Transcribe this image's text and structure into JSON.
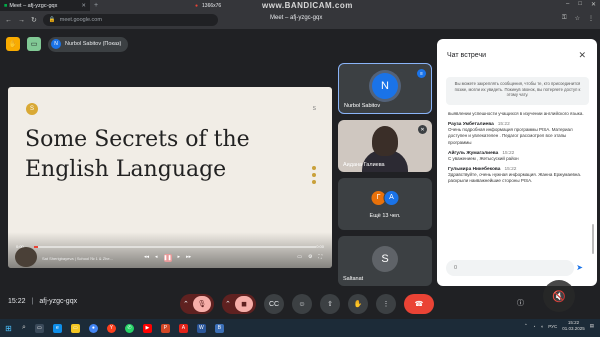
{
  "browser": {
    "tab_title": "Meet – afj-yzgc-gqx",
    "tab_close": "✕",
    "new_tab": "+",
    "url": "meet.google.com",
    "page_title": "Meet – afj-yzgc-gqx",
    "recorder_resolution": "1366x76",
    "watermark": "www.BANDICAM.com",
    "window_controls": [
      "–",
      "□",
      "✕"
    ]
  },
  "meet": {
    "presenter_chip": "Nurbol Sabitov (Показ)",
    "presenter_initial": "N",
    "slide": {
      "badge": "S",
      "page_marker": "S",
      "headline": "Some Secrets of the English Language",
      "video_time": "0:00",
      "video_duration": "0:00",
      "caption": "Sat Sherigbayeva | School № 1 & Zhe..."
    },
    "tiles": [
      {
        "name": "Nurbol Sabitov",
        "initial": "N",
        "color": "#1a73e8"
      },
      {
        "name": "Аидана Галиева"
      },
      {
        "name": "Ещё 13 чел.",
        "initials": [
          "Г",
          "A"
        ],
        "colors": [
          "#e8710a",
          "#1a73e8"
        ]
      },
      {
        "name": "Saltanat",
        "initial": "S",
        "color": "#5f6368"
      }
    ],
    "time": "15:22",
    "meeting_code": "afj-yzgc-gqx",
    "separator": "|"
  },
  "chat": {
    "title": "Чат встречи",
    "notice": "Вы можете закреплять сообщения, чтобы те, кто присоединится позже, могли их увидеть. Покинув звонок, вы потеряете доступ к этому чату.",
    "messages": [
      {
        "author": "",
        "time": "",
        "text": "выявлении успешности учащихся в изучении английского языка."
      },
      {
        "author": "Рауза Умбеталиева",
        "time": "15:22",
        "text": "Очень подробная информация программы PISA. Материал доступен и увлекателен . Педагог рассмотрел все этапы программы"
      },
      {
        "author": "Айгуль Жумагалиева",
        "time": "15:22",
        "text": "С уважением , Жетысуский район"
      },
      {
        "author": "Гульмира Никебекова",
        "time": "15:22",
        "text": "Здравствуйте, очень нужная информация. Жанна Ержумаевна. раскрыли наиважнейшие стороны PISA."
      }
    ],
    "input_value": "0"
  },
  "taskbar": {
    "language": "РУС",
    "clock_time": "15:22",
    "clock_date": "01.03.2025"
  },
  "colors": {
    "accent": "#1a73e8",
    "danger": "#ea4335",
    "surface": "#202124"
  }
}
